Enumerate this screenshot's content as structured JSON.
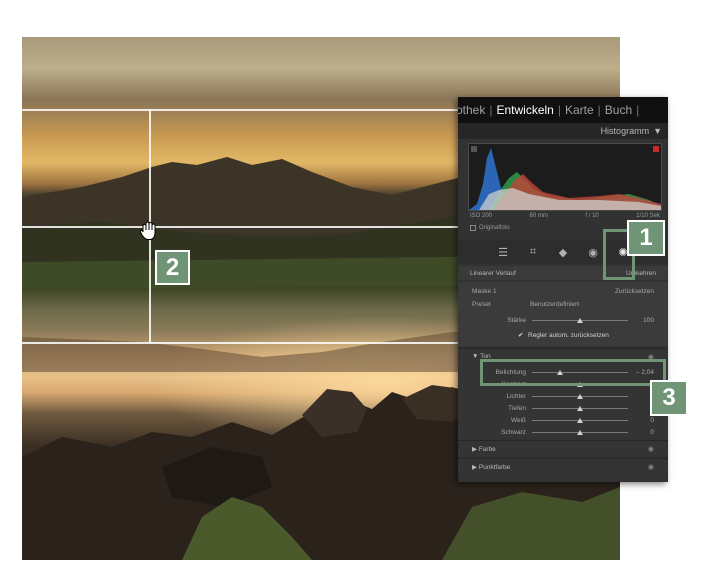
{
  "modules": [
    "othek",
    "Entwickeln",
    "Karte",
    "Buch"
  ],
  "modules_active": "Entwickeln",
  "histogram": {
    "title": "Histogramm",
    "iso": "ISO 200",
    "focal": "60 mm",
    "aperture": "f / 10",
    "shutter": "1/10 Sek",
    "original_label": "Originalfoto"
  },
  "tools": [
    "sliders-icon",
    "crop-icon",
    "heal-icon",
    "redeye-icon",
    "mask-icon"
  ],
  "mask": {
    "name": "Linearer Verlauf",
    "action": "Umkehren",
    "mask_label": "Maske 1",
    "reset": "Zurücksetzen",
    "preset_label": "Preset",
    "preset_value": "Benutzerdefiniert",
    "strength_label": "Stärke",
    "strength_value": "100",
    "strength_level": 1.0,
    "auto_reset": "Regler autom. zurücksetzen"
  },
  "tone": {
    "title": "Ton",
    "sliders": [
      {
        "label": "Belichtung",
        "value": "– 2,04",
        "level": 0.29
      },
      {
        "label": "Kontrast",
        "value": "",
        "level": 0.5
      },
      {
        "label": "Lichter",
        "value": "0",
        "level": 0.5
      },
      {
        "label": "Tiefen",
        "value": "0",
        "level": 0.5
      },
      {
        "label": "Weiß",
        "value": "0",
        "level": 0.5
      },
      {
        "label": "Schwarz",
        "value": "0",
        "level": 0.5
      }
    ]
  },
  "sections": [
    "Farbe",
    "Punktfarbe"
  ],
  "annotations": [
    "1",
    "2",
    "3"
  ],
  "colors": {
    "accent": "#6f9476"
  }
}
